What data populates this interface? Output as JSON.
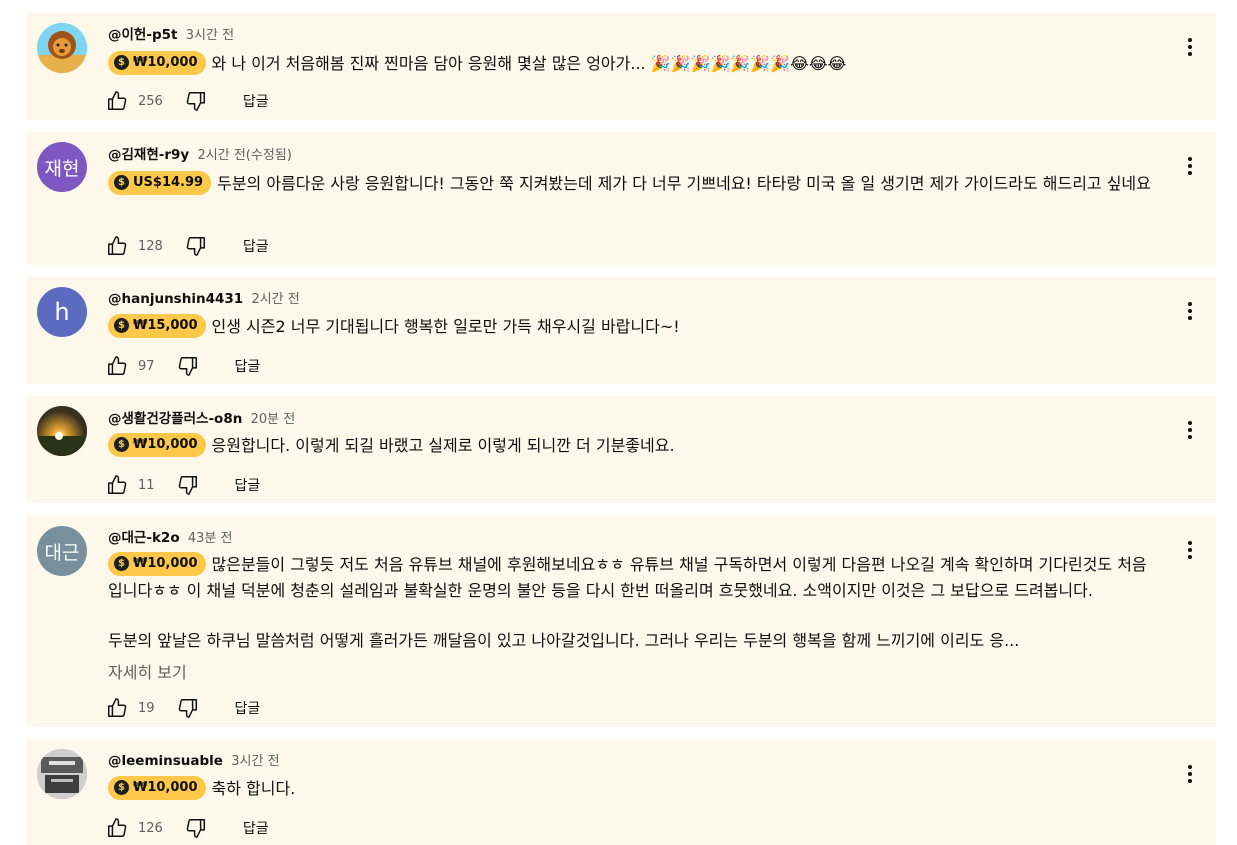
{
  "reply_label": "답글",
  "more_label": "자세히 보기",
  "comments": [
    {
      "author": "@이헌-p5t",
      "time": "3시간 전",
      "amount": "₩10,000",
      "text": "와 나 이거 처음해봄 진짜 찐마음 담아 응원해 몇살 많은 엉아가... 🎉🎉🎉🎉🎉🎉🎉😂😂😂",
      "likes": "256",
      "avatar": {
        "kind": "image",
        "label": "lion-avatar"
      }
    },
    {
      "author": "@김재현-r9y",
      "time": "2시간 전(수정됨)",
      "amount": "US$14.99",
      "text": "두분의 아름다운 사랑 응원합니다! 그동안 쭉 지켜봤는데 제가 다 너무 기쁘네요! 타타랑 미국 올 일 생기면 제가 가이드라도 해드리고 싶네요",
      "likes": "128",
      "avatar": {
        "kind": "letter",
        "letter": "재현",
        "color": "#7e57c2"
      }
    },
    {
      "author": "@hanjunshin4431",
      "time": "2시간 전",
      "amount": "₩15,000",
      "text": "인생 시즌2 너무 기대됩니다 행복한 일로만 가득 채우시길 바랍니다~!",
      "likes": "97",
      "avatar": {
        "kind": "letter",
        "letter": "h",
        "color": "#5c6bc0"
      }
    },
    {
      "author": "@생활건강플러스-o8n",
      "time": "20분 전",
      "amount": "₩10,000",
      "text": "응원합니다. 이렇게 되길 바랬고 실제로 이렇게 되니깐 더 기분좋네요.",
      "likes": "11",
      "avatar": {
        "kind": "image",
        "label": "sunset-avatar"
      }
    },
    {
      "author": "@대근-k2o",
      "time": "43분 전",
      "amount": "₩10,000",
      "text": "많은분들이 그렇듯 저도 처음 유튜브 채널에 후원해보네요ㅎㅎ 유튜브 채널 구독하면서 이렇게 다음편 나오길 계속 확인하며 기다린것도 처음입니다ㅎㅎ 이 채널 덕분에 청춘의 설레임과 불확실한 운명의 불안 등을 다시 한번 떠올리며 흐뭇했네요. 소액이지만 이것은 그 보답으로 드려봅니다.",
      "text2": "두분의 앞날은 하쿠님 말씀처럼 어떻게 흘러가든 깨달음이 있고 나아갈것입니다. 그러나 우리는 두분의 행복을 함께 느끼기에 이리도 응...",
      "likes": "19",
      "avatar": {
        "kind": "letter",
        "letter": "대근",
        "color": "#78909c"
      }
    },
    {
      "author": "@leeminsuable",
      "time": "3시간 전",
      "amount": "₩10,000",
      "text": "축하 합니다.",
      "likes": "126",
      "avatar": {
        "kind": "image",
        "label": "photo-avatar"
      }
    }
  ]
}
